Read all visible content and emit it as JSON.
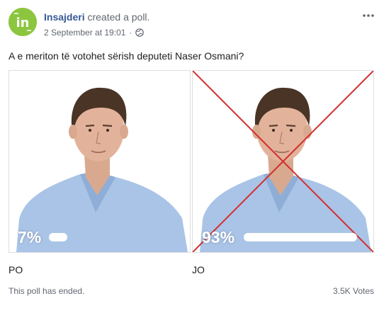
{
  "header": {
    "author": "Insajderi",
    "action": "created a poll.",
    "date": "2 September at 19:01",
    "separator": "·",
    "privacy_icon": "globe-icon",
    "more_icon": "more-icon",
    "avatar_text": "in",
    "avatar_color": "#8cc63f"
  },
  "poll": {
    "question": "A e meriton të votohet sërish deputeti Naser Osmani?",
    "options": [
      {
        "label": "PO",
        "percent_text": "7%",
        "share": 0.07
      },
      {
        "label": "JO",
        "percent_text": "93%",
        "share": 0.93,
        "crossed_out": true
      }
    ],
    "status": "This poll has ended.",
    "votes": "3.5K Votes"
  },
  "colors": {
    "link": "#385898",
    "meta": "#616770",
    "cross": "#d32f2f",
    "shirt": "#a9c4e6"
  }
}
